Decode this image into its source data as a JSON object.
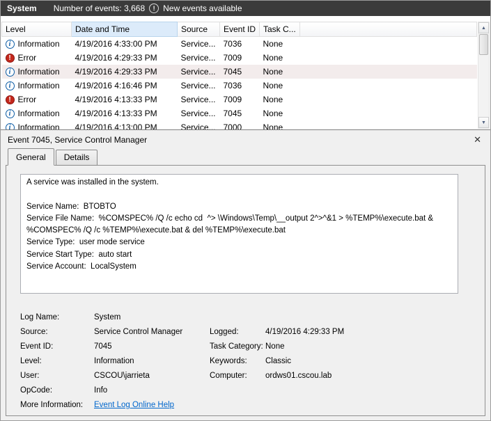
{
  "colors": {
    "topbar_bg": "#3b3b3b",
    "sorted_column_bg": "#dcebfa",
    "selected_row_bg": "#f3ecec",
    "error_red": "#c4281c",
    "info_blue": "#0c5ca5",
    "link_blue": "#0066cc"
  },
  "icons": {
    "new_events": "!",
    "scroll_up": "▲",
    "scroll_down": "▼",
    "close": "✕"
  },
  "header": {
    "log_name": "System",
    "events_count": "Number of events: 3,668",
    "new_events": "New events available"
  },
  "event_table": {
    "columns": [
      "Level",
      "Date and Time",
      "Source",
      "Event ID",
      "Task C..."
    ],
    "sorted_by": "Date and Time",
    "rows": [
      {
        "icon": "info",
        "level": "Information",
        "datetime": "4/19/2016 4:33:00 PM",
        "source": "Service...",
        "event_id": "7036",
        "task": "None",
        "selected": false
      },
      {
        "icon": "error",
        "level": "Error",
        "datetime": "4/19/2016 4:29:33 PM",
        "source": "Service...",
        "event_id": "7009",
        "task": "None",
        "selected": false
      },
      {
        "icon": "info",
        "level": "Information",
        "datetime": "4/19/2016 4:29:33 PM",
        "source": "Service...",
        "event_id": "7045",
        "task": "None",
        "selected": true
      },
      {
        "icon": "info",
        "level": "Information",
        "datetime": "4/19/2016 4:16:46 PM",
        "source": "Service...",
        "event_id": "7036",
        "task": "None",
        "selected": false
      },
      {
        "icon": "error",
        "level": "Error",
        "datetime": "4/19/2016 4:13:33 PM",
        "source": "Service...",
        "event_id": "7009",
        "task": "None",
        "selected": false
      },
      {
        "icon": "info",
        "level": "Information",
        "datetime": "4/19/2016 4:13:33 PM",
        "source": "Service...",
        "event_id": "7045",
        "task": "None",
        "selected": false
      },
      {
        "icon": "info",
        "level": "Information",
        "datetime": "4/19/2016 4:13:00 PM",
        "source": "Service...",
        "event_id": "7000",
        "task": "None",
        "selected": false
      }
    ]
  },
  "preview": {
    "title": "Event 7045, Service Control Manager",
    "tabs": [
      "General",
      "Details"
    ],
    "active_tab": "General",
    "description_lines": [
      "A service was installed in the system.",
      "",
      "Service Name:  BTOBTO",
      "Service File Name:  %COMSPEC% /Q /c echo cd  ^> \\Windows\\Temp\\__output 2^>^&1 > %TEMP%\\execute.bat & %COMSPEC% /Q /c %TEMP%\\execute.bat & del %TEMP%\\execute.bat",
      "Service Type:  user mode service",
      "Service Start Type:  auto start",
      "Service Account:  LocalSystem"
    ],
    "properties": [
      {
        "label": "Log Name:",
        "value": "System",
        "label2": "",
        "value2": ""
      },
      {
        "label": "Source:",
        "value": "Service Control Manager",
        "label2": "Logged:",
        "value2": "4/19/2016 4:29:33 PM"
      },
      {
        "label": "Event ID:",
        "value": "7045",
        "label2": "Task Category:",
        "value2": "None"
      },
      {
        "label": "Level:",
        "value": "Information",
        "label2": "Keywords:",
        "value2": "Classic"
      },
      {
        "label": "User:",
        "value": "CSCOU\\jarrieta",
        "label2": "Computer:",
        "value2": "ordws01.cscou.lab"
      },
      {
        "label": "OpCode:",
        "value": "Info",
        "label2": "",
        "value2": ""
      },
      {
        "label": "More Information:",
        "value": "",
        "link": "Event Log Online Help",
        "label2": "",
        "value2": ""
      }
    ]
  }
}
